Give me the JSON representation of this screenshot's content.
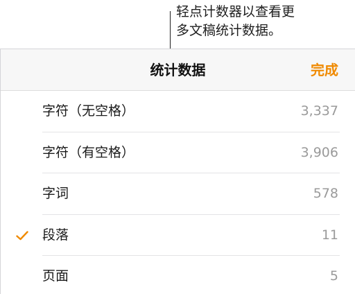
{
  "callout": {
    "text": "轻点计数器以查看更\n多文稿统计数据。"
  },
  "header": {
    "title": "统计数据",
    "done_label": "完成"
  },
  "rows": [
    {
      "label": "字符（无空格）",
      "value": "3,337",
      "checked": false
    },
    {
      "label": "字符（有空格）",
      "value": "3,906",
      "checked": false
    },
    {
      "label": "字词",
      "value": "578",
      "checked": false
    },
    {
      "label": "段落",
      "value": "11",
      "checked": true
    },
    {
      "label": "页面",
      "value": "5",
      "checked": false
    }
  ],
  "colors": {
    "accent": "#f08a00",
    "value_text": "#9a9a9a"
  },
  "icons": {
    "checkmark": "check-icon"
  }
}
